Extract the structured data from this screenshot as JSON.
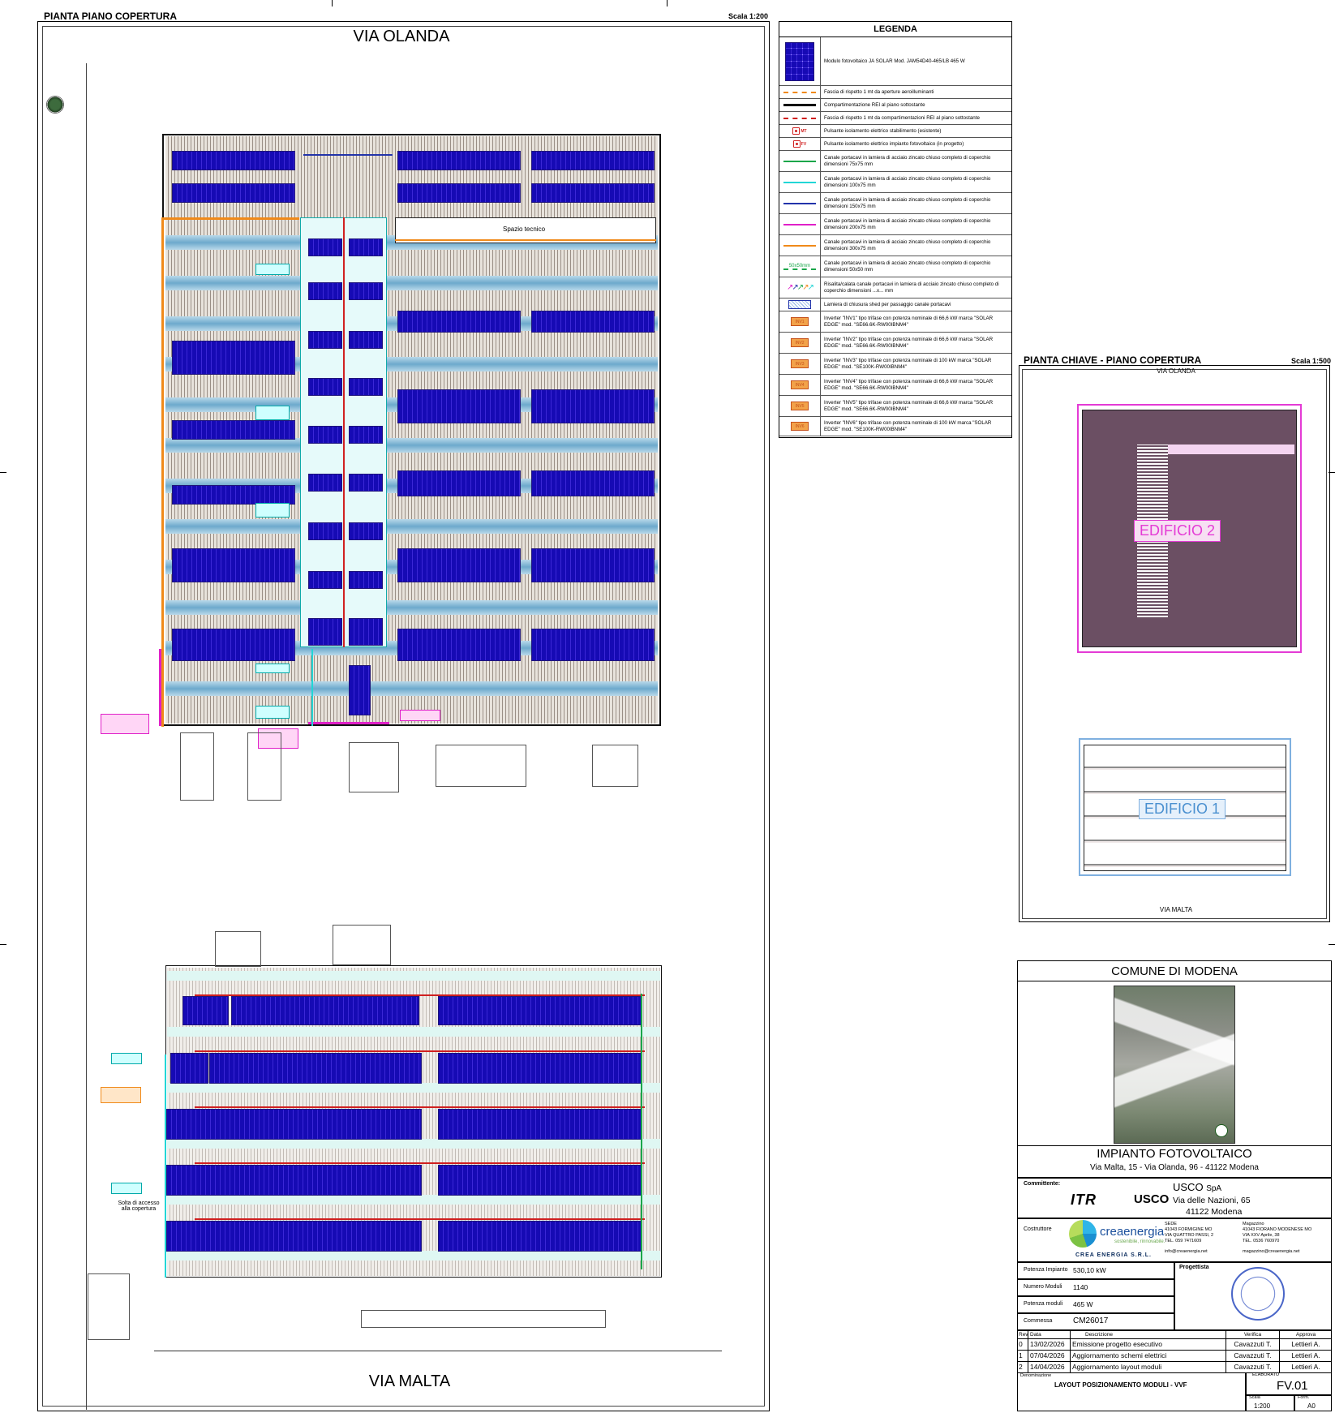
{
  "sheet": {
    "main_title": "PIANTA PIANO COPERTURA",
    "main_scale": "Scala 1:200",
    "street_top": "VIA OLANDA",
    "street_bottom": "VIA MALTA",
    "technical_space": "Spazio tecnico",
    "roof_access": "Solta di accesso\nalla copertura"
  },
  "legend": {
    "title": "LEGENDA",
    "items": [
      {
        "symbol": "pv-module-icon",
        "text": "Modulo fotovoltaico JA SOLAR Mod. JAM54D40-465/LB 465 W"
      },
      {
        "symbol": "dashed-orange-line",
        "text": "Fascia di rispetto 1 mt da aperture aeroilluminanti"
      },
      {
        "symbol": "thick-black-line",
        "text": "Compartimentazione REI al piano sottostante"
      },
      {
        "symbol": "dashed-red-line",
        "text": "Fascia di rispetto 1 mt da compartimentazioni REI al piano sottostante"
      },
      {
        "symbol": "mt-button-icon",
        "label": "MT",
        "text": "Pulsante isolamento elettrico stabilimento (esistente)"
      },
      {
        "symbol": "fv-button-icon",
        "label": "FV",
        "text": "Pulsante isolamento elettrico impianto fotovoltaico (in progetto)"
      },
      {
        "symbol": "green-line",
        "color": "#1aa64a",
        "text": "Canale portacavi in lamiera di acciaio zincato chiuso completo di coperchio dimensioni 75x75 mm"
      },
      {
        "symbol": "cyan-line",
        "color": "#22d6d6",
        "text": "Canale portacavi in lamiera di acciaio zincato chiuso completo di coperchio dimensioni 100x75 mm"
      },
      {
        "symbol": "blue-line",
        "color": "#2233aa",
        "text": "Canale portacavi in lamiera di acciaio zincato chiuso completo di coperchio dimensioni 150x75 mm"
      },
      {
        "symbol": "magenta-line",
        "color": "#e020c8",
        "text": "Canale portacavi in lamiera di acciaio zincato chiuso completo di coperchio dimensioni 200x75 mm"
      },
      {
        "symbol": "orange-line",
        "color": "#f08a1a",
        "text": "Canale portacavi in lamiera di acciaio zincato chiuso completo di coperchio dimensioni 300x75 mm"
      },
      {
        "symbol": "green-dashed-50-line",
        "label": "50x50mm",
        "text": "Canale portacavi in lamiera di acciaio zincato chiuso completo di coperchio dimensioni 50x50 mm"
      },
      {
        "symbol": "riser-arrows-icon",
        "text": "Risalita/calata canale portacavi in lamiera di acciaio zincato chiuso completo di coperchio dimensioni ...x... mm"
      },
      {
        "symbol": "shed-closure-icon",
        "text": "Lamiera di chiusura shed per passaggio canale portacavi"
      },
      {
        "symbol": "inverter-icon",
        "label": "INV1",
        "text": "Inverter \"INV1\" tipo trifase con potenza nominale di 66,6 kW marca \"SOLAR EDGE\" mod. \"SE66.6K-RW00IBNM4\""
      },
      {
        "symbol": "inverter-icon",
        "label": "INV2",
        "text": "Inverter \"INV2\" tipo trifase con potenza nominale di 66,6 kW marca \"SOLAR EDGE\" mod. \"SE66.6K-RW00IBNM4\""
      },
      {
        "symbol": "inverter-icon",
        "label": "INV3",
        "text": "Inverter \"INV3\" tipo trifase con potenza nominale di 100 kW marca \"SOLAR EDGE\" mod. \"SE100K-RW00IBNM4\""
      },
      {
        "symbol": "inverter-icon",
        "label": "INV4",
        "text": "Inverter \"INV4\" tipo trifase con potenza nominale di 66,6 kW marca \"SOLAR EDGE\" mod. \"SE66.6K-RW00IBNM4\""
      },
      {
        "symbol": "inverter-icon",
        "label": "INV5",
        "text": "Inverter \"INV5\" tipo trifase con potenza nominale di 66,6 kW marca \"SOLAR EDGE\" mod. \"SE66.6K-RW00IBNM4\""
      },
      {
        "symbol": "inverter-icon",
        "label": "INV6",
        "text": "Inverter \"INV6\" tipo trifase con potenza nominale di 100 kW marca \"SOLAR EDGE\" mod. \"SE100K-RW00IBNM4\""
      }
    ]
  },
  "key_plan": {
    "title": "PIANTA CHIAVE - PIANO COPERTURA",
    "scale": "Scala 1:500",
    "street_top": "VIA OLANDA",
    "street_bottom": "VIA MALTA",
    "building_2": "EDIFICIO 2",
    "building_1": "EDIFICIO 1"
  },
  "title_block": {
    "municipality": "COMUNE DI MODENA",
    "project_title": "IMPIANTO FOTOVOLTAICO",
    "project_address": "Via Malta, 15 - Via Olanda, 96 - 41122 Modena",
    "client_label": "Committente:",
    "client_logo_1": "ITR",
    "client_logo_2": "USCO",
    "client_name": "USCO",
    "client_suffix": "SpA",
    "client_address_1": "Via delle Nazioni, 65",
    "client_address_2": "41122 Modena",
    "builder_label": "Costruttore",
    "builder_logo": "creaenergia",
    "builder_tagline": "sostenibile, rinnovabile.",
    "builder_brand_2": "CREA ENERGIA S.R.L.",
    "office_1": "SEDE\n41043 FORMIGINE MO\nVIA QUATTRO PASSI, 2\nTEL. 059 7471609",
    "office_2": "Magazzino\n41043 FIORANO MODENESE MO\nVIA XXV Aprile, 38\nTEL. 0536 760970",
    "email_1": "info@creaenergia.net",
    "email_2": "magazzino@creaenergia.net",
    "power_label": "Potenza Impianto",
    "power_value": "530,10 kW",
    "modules_label": "Numero Moduli",
    "modules_value": "1140",
    "module_power_label": "Potenza moduli",
    "module_power_value": "465 W",
    "job_label": "Commessa",
    "job_value": "CM26017",
    "designer_label": "Progettista",
    "rev_headers": {
      "rev": "Rev.",
      "date": "Data",
      "desc": "Descrizione",
      "check": "Verifica",
      "approve": "Approva"
    },
    "revisions": [
      {
        "rev": "0",
        "date": "13/02/2026",
        "desc": "Emissione progetto esecutivo",
        "check": "Cavazzuti T.",
        "approve": "Lettieri A."
      },
      {
        "rev": "1",
        "date": "07/04/2026",
        "desc": "Aggiornamento schemi elettrici",
        "check": "Cavazzuti T.",
        "approve": "Lettieri A."
      },
      {
        "rev": "2",
        "date": "14/04/2026",
        "desc": "Aggiornamento layout moduli",
        "check": "Cavazzuti T.",
        "approve": "Lettieri A."
      }
    ],
    "denomination_label": "Denominazione",
    "denomination_value": "LAYOUT POSIZIONAMENTO MODULI - VVF",
    "drawing_label": "ELABORATO",
    "drawing_value": "FV.01",
    "scale_label": "Scala",
    "scale_value": "1:200",
    "format_label": "Form.",
    "format_value": "A0"
  }
}
